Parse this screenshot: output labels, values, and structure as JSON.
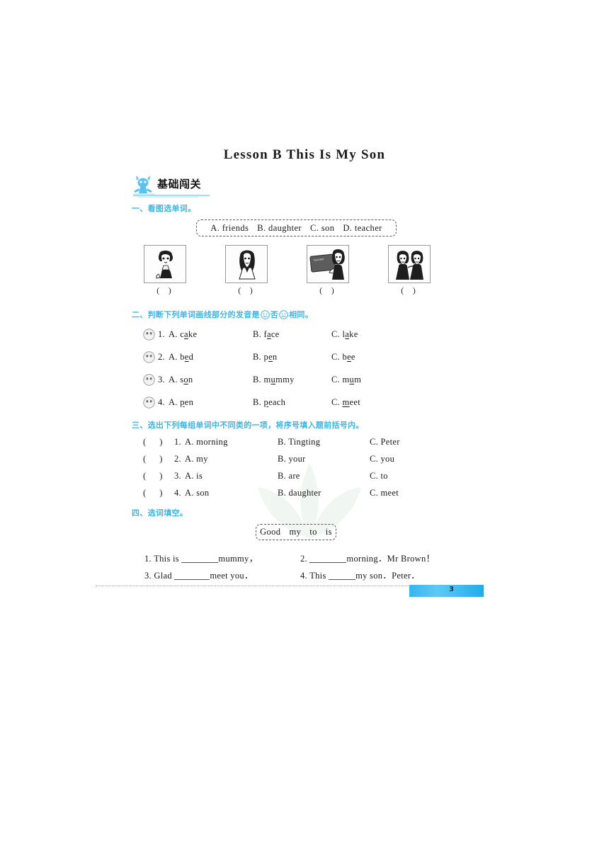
{
  "document": {
    "title": "Lesson B    This Is My Son",
    "page_number": "3"
  },
  "badge": {
    "label": "基础闯关",
    "mascot_icon": "blue-mascot-icon"
  },
  "section1": {
    "heading": "一、看图选单词。",
    "wordbank": [
      "A. friends",
      "B. daughter",
      "C. son",
      "D. teacher"
    ],
    "pictures": [
      {
        "icon": "boy-portrait-image",
        "answer_paren": "(      )"
      },
      {
        "icon": "girl-portrait-image",
        "answer_paren": "(      )"
      },
      {
        "icon": "teacher-blackboard-image",
        "answer_paren": "(      )"
      },
      {
        "icon": "two-friends-image",
        "answer_paren": "(      )"
      }
    ]
  },
  "section2": {
    "heading_part1": "二、判断下列单词画线部分的发音是",
    "heading_part2": "否",
    "heading_part3": "相同。",
    "smile_icon": "smiley-face-icon",
    "frown_icon": "frowny-face-icon",
    "items": [
      {
        "face_icon": "face-circle-icon",
        "number": "1.",
        "a": {
          "prefix": "A. ",
          "pre": "c",
          "mid": "a",
          "post": "ke"
        },
        "b": {
          "prefix": "B. ",
          "pre": "f",
          "mid": "a",
          "post": "ce"
        },
        "c": {
          "prefix": "C. ",
          "pre": "l",
          "mid": "a",
          "post": "ke"
        }
      },
      {
        "face_icon": "face-circle-icon",
        "number": "2.",
        "a": {
          "prefix": "A. ",
          "pre": "b",
          "mid": "e",
          "post": "d"
        },
        "b": {
          "prefix": "B. ",
          "pre": "p",
          "mid": "e",
          "post": "n"
        },
        "c": {
          "prefix": "C. ",
          "pre": "b",
          "mid": "e",
          "post": "e"
        }
      },
      {
        "face_icon": "face-circle-icon",
        "number": "3.",
        "a": {
          "prefix": "A. ",
          "pre": "s",
          "mid": "o",
          "post": "n"
        },
        "b": {
          "prefix": "B. ",
          "pre": "m",
          "mid": "u",
          "post": "mmy"
        },
        "c": {
          "prefix": "C. ",
          "pre": "m",
          "mid": "u",
          "post": "m"
        }
      },
      {
        "face_icon": "face-circle-icon",
        "number": "4.",
        "a": {
          "prefix": "A. ",
          "pre": "",
          "mid": "p",
          "post": "en"
        },
        "b": {
          "prefix": "B. ",
          "pre": "",
          "mid": "p",
          "post": "each"
        },
        "c": {
          "prefix": "C. ",
          "pre": "",
          "mid": "m",
          "post": "eet"
        }
      }
    ]
  },
  "section3": {
    "heading": "三、选出下列每组单词中不同类的一项，将序号填入题前括号内。",
    "items": [
      {
        "paren": "(      )",
        "number": "1.",
        "a": "A. morning",
        "b": "B. Tingting",
        "c": "C. Peter"
      },
      {
        "paren": "(      )",
        "number": "2.",
        "a": "A. my",
        "b": "B. your",
        "c": "C. you"
      },
      {
        "paren": "(      )",
        "number": "3.",
        "a": "A. is",
        "b": "B. are",
        "c": "C. to"
      },
      {
        "paren": "(      )",
        "number": "4.",
        "a": "A. son",
        "b": "B. daughter",
        "c": "C. meet"
      }
    ]
  },
  "section4": {
    "heading": "四、选词填空。",
    "wordbank": [
      "Good",
      "my",
      "to",
      "is"
    ],
    "items": [
      {
        "number": "1.",
        "before": "This is",
        "after": "mummy，"
      },
      {
        "number": "2.",
        "before": "",
        "after": "morning．Mr Brown！"
      },
      {
        "number": "3.",
        "before": "Glad",
        "after": "meet you．"
      },
      {
        "number": "4.",
        "before": "This",
        "after": "my son．Peter．"
      }
    ]
  }
}
